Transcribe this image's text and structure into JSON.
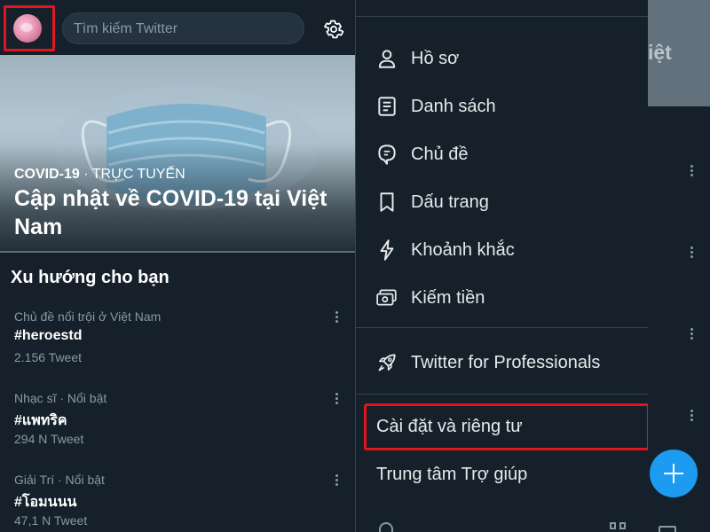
{
  "search": {
    "placeholder": "Tìm kiếm Twitter"
  },
  "hero": {
    "category": "COVID-19",
    "status": "· TRỰC TUYẾN",
    "title": "Cập nhật về COVID-19 tại Việt Nam"
  },
  "trends": {
    "title": "Xu hướng cho bạn",
    "items": [
      {
        "context": "Chủ đề nổi trội ở Việt Nam",
        "name": "#heroestd",
        "count": "2.156 Tweet"
      },
      {
        "context": "Nhạc sĩ · Nổi bật",
        "name": "#แพทริค",
        "count": "294 N Tweet"
      },
      {
        "context": "Giải Trí · Nổi bật",
        "name": "#โอมนนน",
        "count": "47,1 N Tweet"
      }
    ]
  },
  "drawer": {
    "items": [
      {
        "label": "Hồ sơ",
        "icon": "person-icon"
      },
      {
        "label": "Danh sách",
        "icon": "list-icon"
      },
      {
        "label": "Chủ đề",
        "icon": "topics-icon"
      },
      {
        "label": "Dấu trang",
        "icon": "bookmark-icon"
      },
      {
        "label": "Khoảnh khắc",
        "icon": "lightning-icon"
      },
      {
        "label": "Kiếm tiền",
        "icon": "money-icon"
      }
    ],
    "professional": {
      "label": "Twitter for Professionals",
      "icon": "rocket-icon"
    },
    "settings": "Cài đặt và riêng tư",
    "help": "Trung tâm Trợ giúp"
  },
  "right_strip": {
    "faded_text": "iệt"
  },
  "colors": {
    "background": "#15202b",
    "accent": "#1d9bf0",
    "highlight": "#e0151d",
    "muted": "#8899a6"
  }
}
